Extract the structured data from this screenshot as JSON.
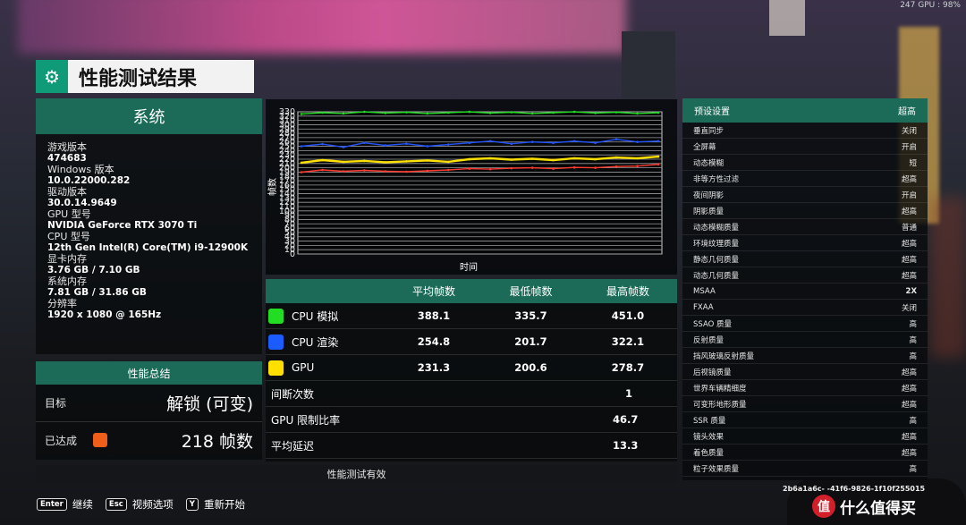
{
  "overlay": {
    "fps_text": "247 GPU : 98%"
  },
  "header": {
    "title": "性能测试结果",
    "logo_icon": "gear-icon"
  },
  "system": {
    "title": "系统",
    "items": [
      {
        "label": "游戏版本",
        "value": "474683"
      },
      {
        "label": "Windows 版本",
        "value": "10.0.22000.282"
      },
      {
        "label": "驱动版本",
        "value": "30.0.14.9649"
      },
      {
        "label": "GPU 型号",
        "value": "NVIDIA GeForce RTX 3070 Ti"
      },
      {
        "label": "CPU 型号",
        "value": "12th Gen Intel(R) Core(TM) i9-12900K"
      },
      {
        "label": "显卡内存",
        "value": "3.76 GB / 7.10 GB"
      },
      {
        "label": "系统内存",
        "value": "7.81 GB / 31.86 GB"
      },
      {
        "label": "分辨率",
        "value": "1920 x 1080 @ 165Hz"
      }
    ]
  },
  "summary": {
    "title": "性能总结",
    "target_label": "目标",
    "target_value": "解锁 (可变)",
    "achieved_label": "已达成",
    "achieved_value": "218 帧数",
    "achieved_color": "#f05f1a"
  },
  "chart_data": {
    "type": "line",
    "xlabel": "时间",
    "ylabel": "帧数",
    "yticks": [
      "330",
      "320",
      "310",
      "300",
      "290",
      "280",
      "270",
      "260",
      "250",
      "240",
      "230",
      "220",
      "210",
      "200",
      "190",
      "180",
      "170",
      "160",
      "150",
      "140",
      "130",
      "120",
      "110",
      "100",
      "90",
      "80",
      "70",
      "60",
      "50",
      "40",
      "30",
      "20",
      "10",
      "0"
    ],
    "ylim": [
      0,
      330
    ],
    "grid": true,
    "series": [
      {
        "name": "CPU 模拟",
        "color": "#22dd22",
        "values": [
          325,
          328,
          326,
          330,
          327,
          329,
          326,
          328,
          330,
          327,
          329,
          326,
          328,
          330,
          327,
          329,
          326,
          328
        ]
      },
      {
        "name": "CPU 渲染",
        "color": "#2255ff",
        "values": [
          250,
          255,
          248,
          258,
          252,
          256,
          250,
          254,
          258,
          262,
          256,
          260,
          258,
          262,
          258,
          266,
          260,
          262
        ]
      },
      {
        "name": "GPU",
        "color": "#ffe000",
        "values": [
          212,
          218,
          214,
          216,
          213,
          215,
          217,
          214,
          220,
          222,
          219,
          221,
          218,
          222,
          220,
          224,
          222,
          226
        ]
      },
      {
        "color": "#ff3b2f",
        "values": [
          190,
          195,
          192,
          194,
          192,
          191,
          193,
          195,
          198,
          197,
          199,
          200,
          198,
          201,
          200,
          203,
          204,
          208
        ]
      }
    ]
  },
  "table": {
    "headers": [
      "平均帧数",
      "最低帧数",
      "最高帧数"
    ],
    "rows": [
      {
        "name": "CPU 模拟",
        "color": "#22dd22",
        "avg": "388.1",
        "min": "335.7",
        "max": "451.0"
      },
      {
        "name": "CPU 渲染",
        "color": "#1a5cff",
        "avg": "254.8",
        "min": "201.7",
        "max": "322.1"
      },
      {
        "name": "GPU",
        "color": "#ffe000",
        "avg": "231.3",
        "min": "200.6",
        "max": "278.7"
      }
    ],
    "stats": [
      {
        "label": "间断次数",
        "value": "1"
      },
      {
        "label": "GPU 限制比率",
        "value": "46.7"
      },
      {
        "label": "平均延迟",
        "value": "13.3"
      }
    ]
  },
  "valid_text": "性能测试有效",
  "presets": {
    "title": "预设设置",
    "title_value": "超高",
    "rows": [
      {
        "label": "垂直同步",
        "value": "关闭"
      },
      {
        "label": "全屏幕",
        "value": "开启"
      },
      {
        "label": "动态模糊",
        "value": "短"
      },
      {
        "label": "非等方性过滤",
        "value": "超高"
      },
      {
        "label": "夜间阴影",
        "value": "开启"
      },
      {
        "label": "阴影质量",
        "value": "超高"
      },
      {
        "label": "动态模糊质量",
        "value": "普通"
      },
      {
        "label": "环境纹理质量",
        "value": "超高"
      },
      {
        "label": "静态几何质量",
        "value": "超高"
      },
      {
        "label": "动态几何质量",
        "value": "超高"
      },
      {
        "label": "MSAA",
        "value": "2X"
      },
      {
        "label": "FXAA",
        "value": "关闭"
      },
      {
        "label": "SSAO 质量",
        "value": "高"
      },
      {
        "label": "反射质量",
        "value": "高"
      },
      {
        "label": "挡风玻璃反射质量",
        "value": "高"
      },
      {
        "label": "后视镜质量",
        "value": "超高"
      },
      {
        "label": "世界车辆精细度",
        "value": "超高"
      },
      {
        "label": "可变形地形质量",
        "value": "超高"
      },
      {
        "label": "SSR 质量",
        "value": "高"
      },
      {
        "label": "镜头效果",
        "value": "超高"
      },
      {
        "label": "着色质量",
        "value": "超高"
      },
      {
        "label": "粒子效果质量",
        "value": "高"
      }
    ]
  },
  "hash": "2b6a1a6c-  -41f6-9826-1f10f255015",
  "keys": [
    {
      "cap": "Enter",
      "label": "继续"
    },
    {
      "cap": "Esc",
      "label": "视频选项"
    },
    {
      "cap": "Y",
      "label": "重新开始"
    }
  ],
  "watermark": {
    "icon": "值",
    "text": "什么值得买"
  }
}
